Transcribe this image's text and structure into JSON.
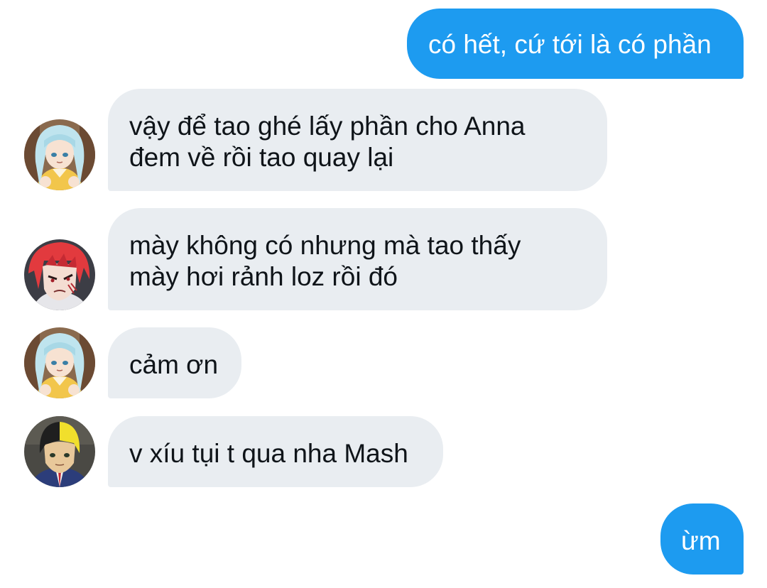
{
  "conversation": {
    "messages": [
      {
        "direction": "outgoing",
        "text": "có hết, cứ tới là có phần"
      },
      {
        "direction": "incoming",
        "avatar": "blue-haired-girl-avatar",
        "text": "vậy để tao ghé lấy phần cho Anna\nđem về rồi tao quay lại"
      },
      {
        "direction": "incoming",
        "avatar": "red-haired-boy-avatar",
        "text": "mày không có nhưng mà tao thấy\nmày hơi rảnh loz rồi đó"
      },
      {
        "direction": "incoming",
        "avatar": "blue-haired-girl-avatar",
        "text": "cảm ơn"
      },
      {
        "direction": "incoming",
        "avatar": "two-tone-haired-boy-avatar",
        "text": "v xíu tụi t qua nha Mash"
      },
      {
        "direction": "outgoing",
        "text": "ừm"
      }
    ]
  },
  "colors": {
    "outgoing_bubble": "#1d9bf0",
    "incoming_bubble": "#e9edf1",
    "outgoing_text": "#ffffff",
    "incoming_text": "#0f1419"
  }
}
